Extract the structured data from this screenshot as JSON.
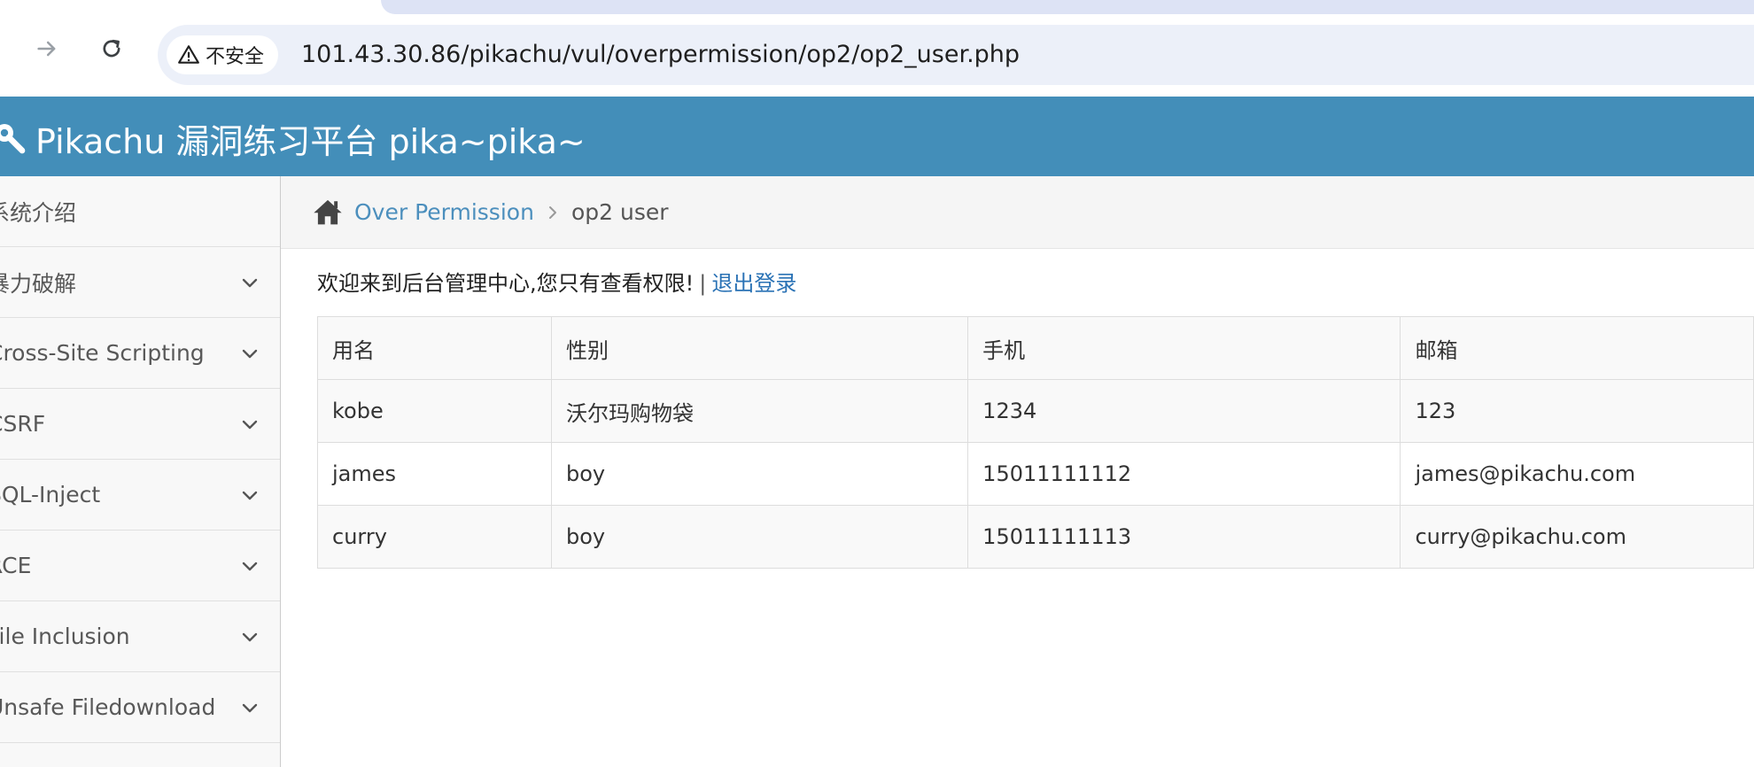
{
  "browser": {
    "security_label": "不安全",
    "url": "101.43.30.86/pikachu/vul/overpermission/op2/op2_user.php",
    "icons": [
      "forward-arrow-icon",
      "reload-icon",
      "warning-icon"
    ]
  },
  "header": {
    "title": "Pikachu 漏洞练习平台 pika~pika~",
    "icon": "wrench-icon",
    "background": "#438eb9"
  },
  "sidebar": {
    "items": [
      {
        "label": "系统介绍",
        "expandable": false
      },
      {
        "label": "暴力破解",
        "expandable": true
      },
      {
        "label": "Cross-Site Scripting",
        "expandable": true
      },
      {
        "label": "CSRF",
        "expandable": true
      },
      {
        "label": "SQL-Inject",
        "expandable": true
      },
      {
        "label": "RCE",
        "expandable": true
      },
      {
        "label": "File Inclusion",
        "expandable": true
      },
      {
        "label": "Unsafe Filedownload",
        "expandable": true
      }
    ]
  },
  "breadcrumb": {
    "parent": "Over Permission",
    "current": "op2 user"
  },
  "main": {
    "welcome": "欢迎来到后台管理中心,您只有查看权限!",
    "separator": "|",
    "logout": "退出登录",
    "table": {
      "headers": [
        "用名",
        "性别",
        "手机",
        "邮箱"
      ],
      "rows": [
        [
          "kobe",
          "沃尔玛购物袋",
          "1234",
          "123"
        ],
        [
          "james",
          "boy",
          "15011111112",
          "james@pikachu.com"
        ],
        [
          "curry",
          "boy",
          "15011111113",
          "curry@pikachu.com"
        ]
      ]
    }
  }
}
